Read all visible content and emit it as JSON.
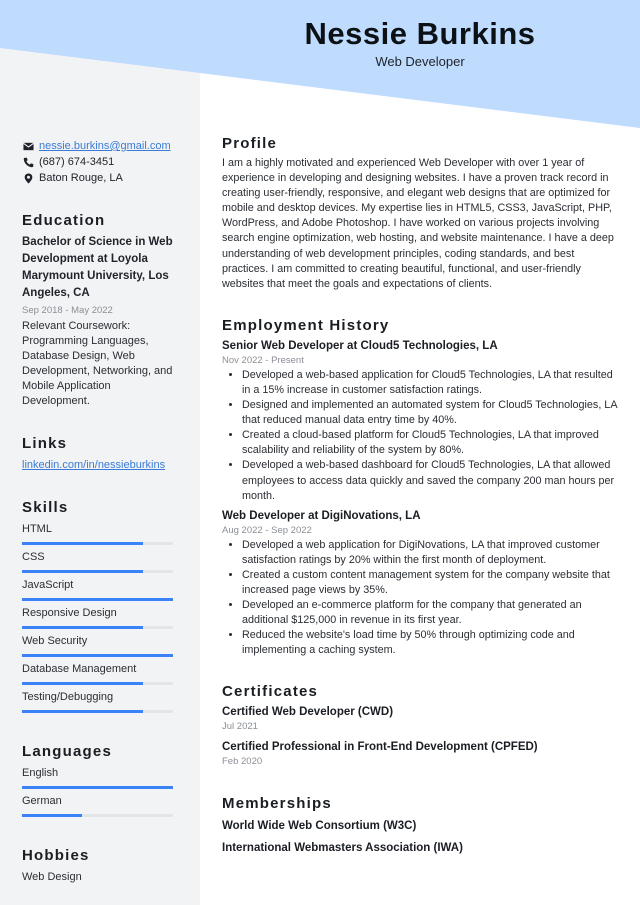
{
  "header": {
    "name": "Nessie Burkins",
    "title": "Web Developer",
    "accent_bg": "#bfdbfe"
  },
  "contact": {
    "email": "nessie.burkins@gmail.com",
    "phone": "(687) 674-3451",
    "location": "Baton Rouge, LA"
  },
  "education": {
    "heading": "Education",
    "degree": "Bachelor of Science in Web Development at Loyola Marymount University, Los Angeles, CA",
    "dates": "Sep 2018 - May 2022",
    "coursework": "Relevant Coursework: Programming Languages, Database Design, Web Development, Networking, and Mobile Application Development."
  },
  "links": {
    "heading": "Links",
    "items": [
      {
        "label": "linkedin.com/in/nessieburkins"
      }
    ]
  },
  "skills": {
    "heading": "Skills",
    "bar_color": "#3b82f6",
    "items": [
      {
        "label": "HTML",
        "level": 0.8
      },
      {
        "label": "CSS",
        "level": 0.8
      },
      {
        "label": "JavaScript",
        "level": 1.0
      },
      {
        "label": "Responsive Design",
        "level": 0.8
      },
      {
        "label": "Web Security",
        "level": 1.0
      },
      {
        "label": "Database Management",
        "level": 0.8
      },
      {
        "label": "Testing/Debugging",
        "level": 0.8
      }
    ]
  },
  "languages": {
    "heading": "Languages",
    "items": [
      {
        "label": "English",
        "level": 1.0
      },
      {
        "label": "German",
        "level": 0.4
      }
    ]
  },
  "hobbies": {
    "heading": "Hobbies",
    "items": [
      "Web Design"
    ]
  },
  "profile": {
    "heading": "Profile",
    "text": "I am a highly motivated and experienced Web Developer with over 1 year of experience in developing and designing websites. I have a proven track record in creating user-friendly, responsive, and elegant web designs that are optimized for mobile and desktop devices. My expertise lies in HTML5, CSS3, JavaScript, PHP, WordPress, and Adobe Photoshop. I have worked on various projects involving search engine optimization, web hosting, and website maintenance. I have a deep understanding of web development principles, coding standards, and best practices. I am committed to creating beautiful, functional, and user-friendly websites that meet the goals and expectations of clients."
  },
  "employment": {
    "heading": "Employment History",
    "jobs": [
      {
        "title": "Senior Web Developer at Cloud5 Technologies, LA",
        "dates": "Nov 2022 - Present",
        "bullets": [
          "Developed a web-based application for Cloud5 Technologies, LA that resulted in a 15% increase in customer satisfaction ratings.",
          "Designed and implemented an automated system for Cloud5 Technologies, LA that reduced manual data entry time by 40%.",
          "Created a cloud-based platform for Cloud5 Technologies, LA that improved scalability and reliability of the system by 80%.",
          "Developed a web-based dashboard for Cloud5 Technologies, LA that allowed employees to access data quickly and saved the company 200 man hours per month."
        ]
      },
      {
        "title": "Web Developer at DigiNovations, LA",
        "dates": "Aug 2022 - Sep 2022",
        "bullets": [
          "Developed a web application for DigiNovations, LA that improved customer satisfaction ratings by 20% within the first month of deployment.",
          "Created a custom content management system for the company website that increased page views by 35%.",
          "Developed an e-commerce platform for the company that generated an additional $125,000 in revenue in its first year.",
          "Reduced the website's load time by 50% through optimizing code and implementing a caching system."
        ]
      }
    ]
  },
  "certificates": {
    "heading": "Certificates",
    "items": [
      {
        "title": "Certified Web Developer (CWD)",
        "date": "Jul 2021"
      },
      {
        "title": "Certified Professional in Front-End Development (CPFED)",
        "date": "Feb 2020"
      }
    ]
  },
  "memberships": {
    "heading": "Memberships",
    "items": [
      "World Wide Web Consortium (W3C)",
      "International Webmasters Association (IWA)"
    ]
  }
}
